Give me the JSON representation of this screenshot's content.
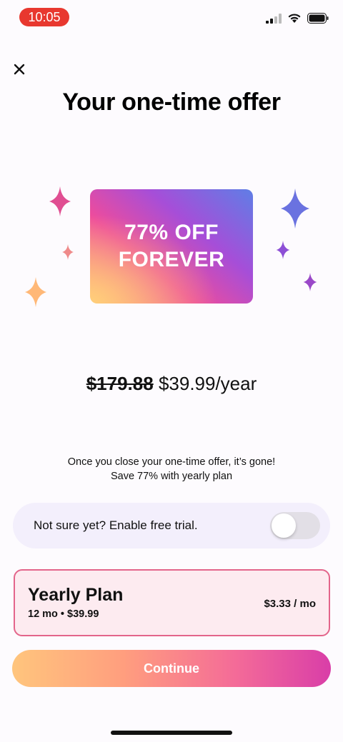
{
  "status_bar": {
    "time": "10:05"
  },
  "header": {
    "title": "Your one-time offer"
  },
  "offer_card": {
    "line1": "77% OFF",
    "line2": "FOREVER"
  },
  "pricing": {
    "old_price": "$179.88",
    "new_price": "$39.99/year"
  },
  "note": {
    "line1": "Once you close your one-time offer, it’s gone!",
    "line2": "Save 77% with yearly plan"
  },
  "trial": {
    "label": "Not sure yet? Enable free trial.",
    "enabled": false
  },
  "plan": {
    "name": "Yearly Plan",
    "detail": "12 mo • $39.99",
    "price": "$3.33 / mo"
  },
  "cta": {
    "label": "Continue"
  },
  "colors": {
    "accent_pink": "#e3658b",
    "card_bg": "#fdebf0",
    "time_pill": "#e8382f",
    "sparkle_pink": "#e04e92",
    "sparkle_blue": "#6a72e0",
    "sparkle_purple": "#9a48c8",
    "sparkle_orange": "#ffb877"
  }
}
